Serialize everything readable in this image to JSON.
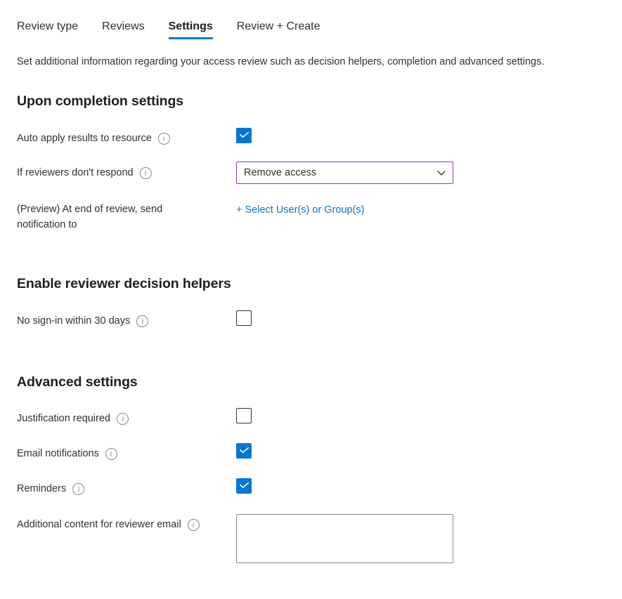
{
  "tabs": [
    {
      "label": "Review type",
      "selected": false
    },
    {
      "label": "Reviews",
      "selected": false
    },
    {
      "label": "Settings",
      "selected": true
    },
    {
      "label": "Review + Create",
      "selected": false
    }
  ],
  "description": "Set additional information regarding your access review such as decision helpers, completion and advanced settings.",
  "sections": {
    "upon_completion": {
      "heading": "Upon completion settings",
      "auto_apply": {
        "label": "Auto apply results to resource",
        "info_icon": "info-icon",
        "checked": "true"
      },
      "if_no_respond": {
        "label": "If reviewers don't respond",
        "info_icon": "info-icon",
        "value": "Remove access",
        "chevron_icon": "chevron-down-icon"
      },
      "notify": {
        "label": "(Preview) At end of review, send notification to",
        "link_label": "+ Select User(s) or Group(s)"
      }
    },
    "decision_helpers": {
      "heading": "Enable reviewer decision helpers",
      "no_signin": {
        "label": "No sign-in within 30 days",
        "info_icon": "info-icon",
        "checked": "false"
      }
    },
    "advanced": {
      "heading": "Advanced settings",
      "justification": {
        "label": "Justification required",
        "info_icon": "info-icon",
        "checked": "false"
      },
      "email_notifications": {
        "label": "Email notifications",
        "info_icon": "info-icon",
        "checked": "true"
      },
      "reminders": {
        "label": "Reminders",
        "info_icon": "info-icon",
        "checked": "true"
      },
      "additional_content": {
        "label": "Additional content for reviewer email",
        "info_icon": "info-icon",
        "value": "",
        "placeholder": ""
      }
    }
  },
  "colors": {
    "accent": "#0078d4",
    "link": "#1273c4",
    "dropdown_border": "#8a3fa0",
    "text": "#323130",
    "border": "#8a8886"
  }
}
